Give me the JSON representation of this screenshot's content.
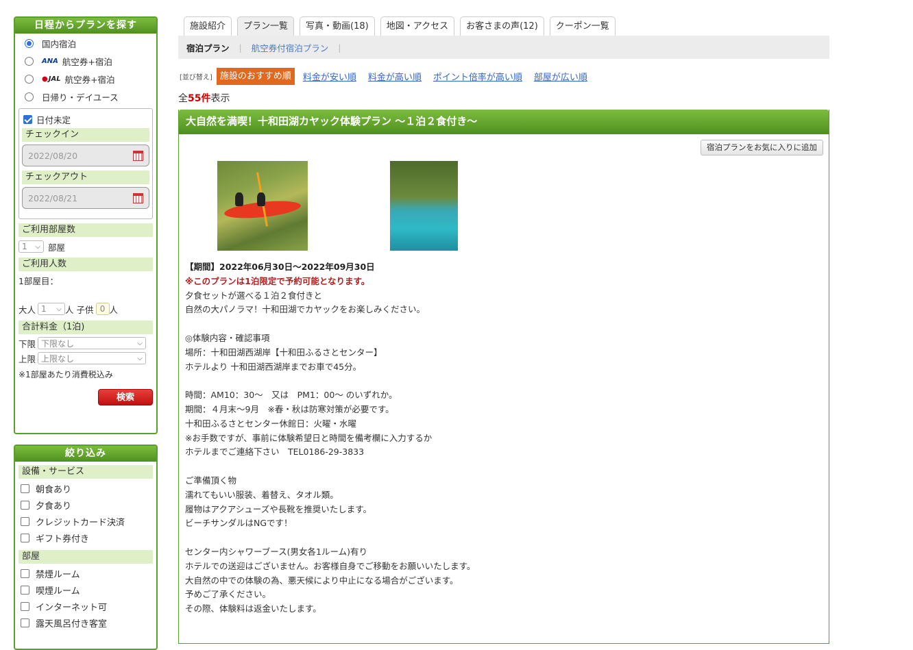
{
  "sidebar": {
    "date_search_title": "日程からプランを探す",
    "radio_options": [
      {
        "airline": "",
        "label": "国内宿泊",
        "selected": true
      },
      {
        "airline": "ANA",
        "label": "航空券+宿泊",
        "selected": false
      },
      {
        "airline": "JAL",
        "label": "航空券+宿泊",
        "selected": false
      },
      {
        "airline": "",
        "label": "日帰り・デイユース",
        "selected": false
      }
    ],
    "date_undecided_label": "日付未定",
    "checkin_label": "チェックイン",
    "checkin_value": "2022/08/20",
    "checkout_label": "チェックアウト",
    "checkout_value": "2022/08/21",
    "rooms_label": "ご利用部屋数",
    "rooms_value": "1",
    "rooms_unit": "部屋",
    "people_label": "ご利用人数",
    "room1_label": "1部屋目：",
    "adult_label": "大人",
    "adult_value": "1",
    "person_unit": "人",
    "child_label": "子供",
    "child_value": "0",
    "price_label": "合計料金（1泊)",
    "min_label": "下限",
    "min_value": "下限なし",
    "max_label": "上限",
    "max_value": "上限なし",
    "tax_note": "※1部屋あたり消費税込み",
    "search_button": "検索",
    "filter_title": "絞り込み",
    "facilities_label": "設備・サービス",
    "facilities": [
      "朝食あり",
      "夕食あり",
      "クレジットカード決済",
      "ギフト券付き"
    ],
    "room_label": "部屋",
    "room_filters": [
      "禁煙ルーム",
      "喫煙ルーム",
      "インターネット可",
      "露天風呂付き客室"
    ]
  },
  "tabs": [
    {
      "label": "施設紹介",
      "active": false
    },
    {
      "label": "プラン一覧",
      "active": true
    },
    {
      "label": "写真・動画(18)",
      "active": false
    },
    {
      "label": "地図・アクセス",
      "active": false
    },
    {
      "label": "お客さまの声(12)",
      "active": false
    },
    {
      "label": "クーポン一覧",
      "active": false
    }
  ],
  "subtabs": {
    "stay": "宿泊プラン",
    "air": "航空券付宿泊プラン"
  },
  "sort": {
    "label": "[並び替え]",
    "active": "施設のおすすめ順",
    "options": [
      "料金が安い順",
      "料金が高い順",
      "ポイント倍率が高い順",
      "部屋が広い順"
    ]
  },
  "count": {
    "prefix": "全",
    "number": "55件",
    "suffix": "表示"
  },
  "plan": {
    "title": "大自然を満喫！十和田湖カヤック体験プラン ～１泊２食付き～",
    "fav_button": "宿泊プランをお気に入りに追加",
    "period": "【期間】2022年06月30日～2022年09月30日",
    "warning": "※このプランは1泊限定で予約可能となります。",
    "lines": [
      "夕食セットが選べる１泊２食付きと",
      "自然の大パノラマ！十和田湖でカヤックをお楽しみください。",
      "",
      "◎体験内容・確認事項",
      "場所：十和田湖西湖岸【十和田ふるさとセンター】",
      "ホテルより 十和田湖西湖岸までお車で45分。",
      "",
      "時間：AM10：30～　又は　PM1：00～ のいずれか。",
      "期間：４月末～9月　※春・秋は防寒対策が必要です。",
      "十和田ふるさとセンター休館日：火曜・水曜",
      "※お手数ですが、事前に体験希望日と時間を備考欄に入力するか",
      "ホテルまでご連絡下さい　TEL0186-29-3833",
      "",
      "ご準備頂く物",
      "濡れてもいい服装、着替え、タオル類。",
      "履物はアクアシューズや長靴を推奨いたします。",
      "ビーチサンダルはNGです！",
      "",
      "センター内シャワーブース(男女各1ルーム)有り",
      "ホテルでの送迎はございません。お客様自身でご移動をお願いいたします。",
      "大自然の中での体験の為、悪天候により中止になる場合がございます。",
      "予めご了承ください。",
      "その際、体験料は返金いたします。"
    ]
  }
}
